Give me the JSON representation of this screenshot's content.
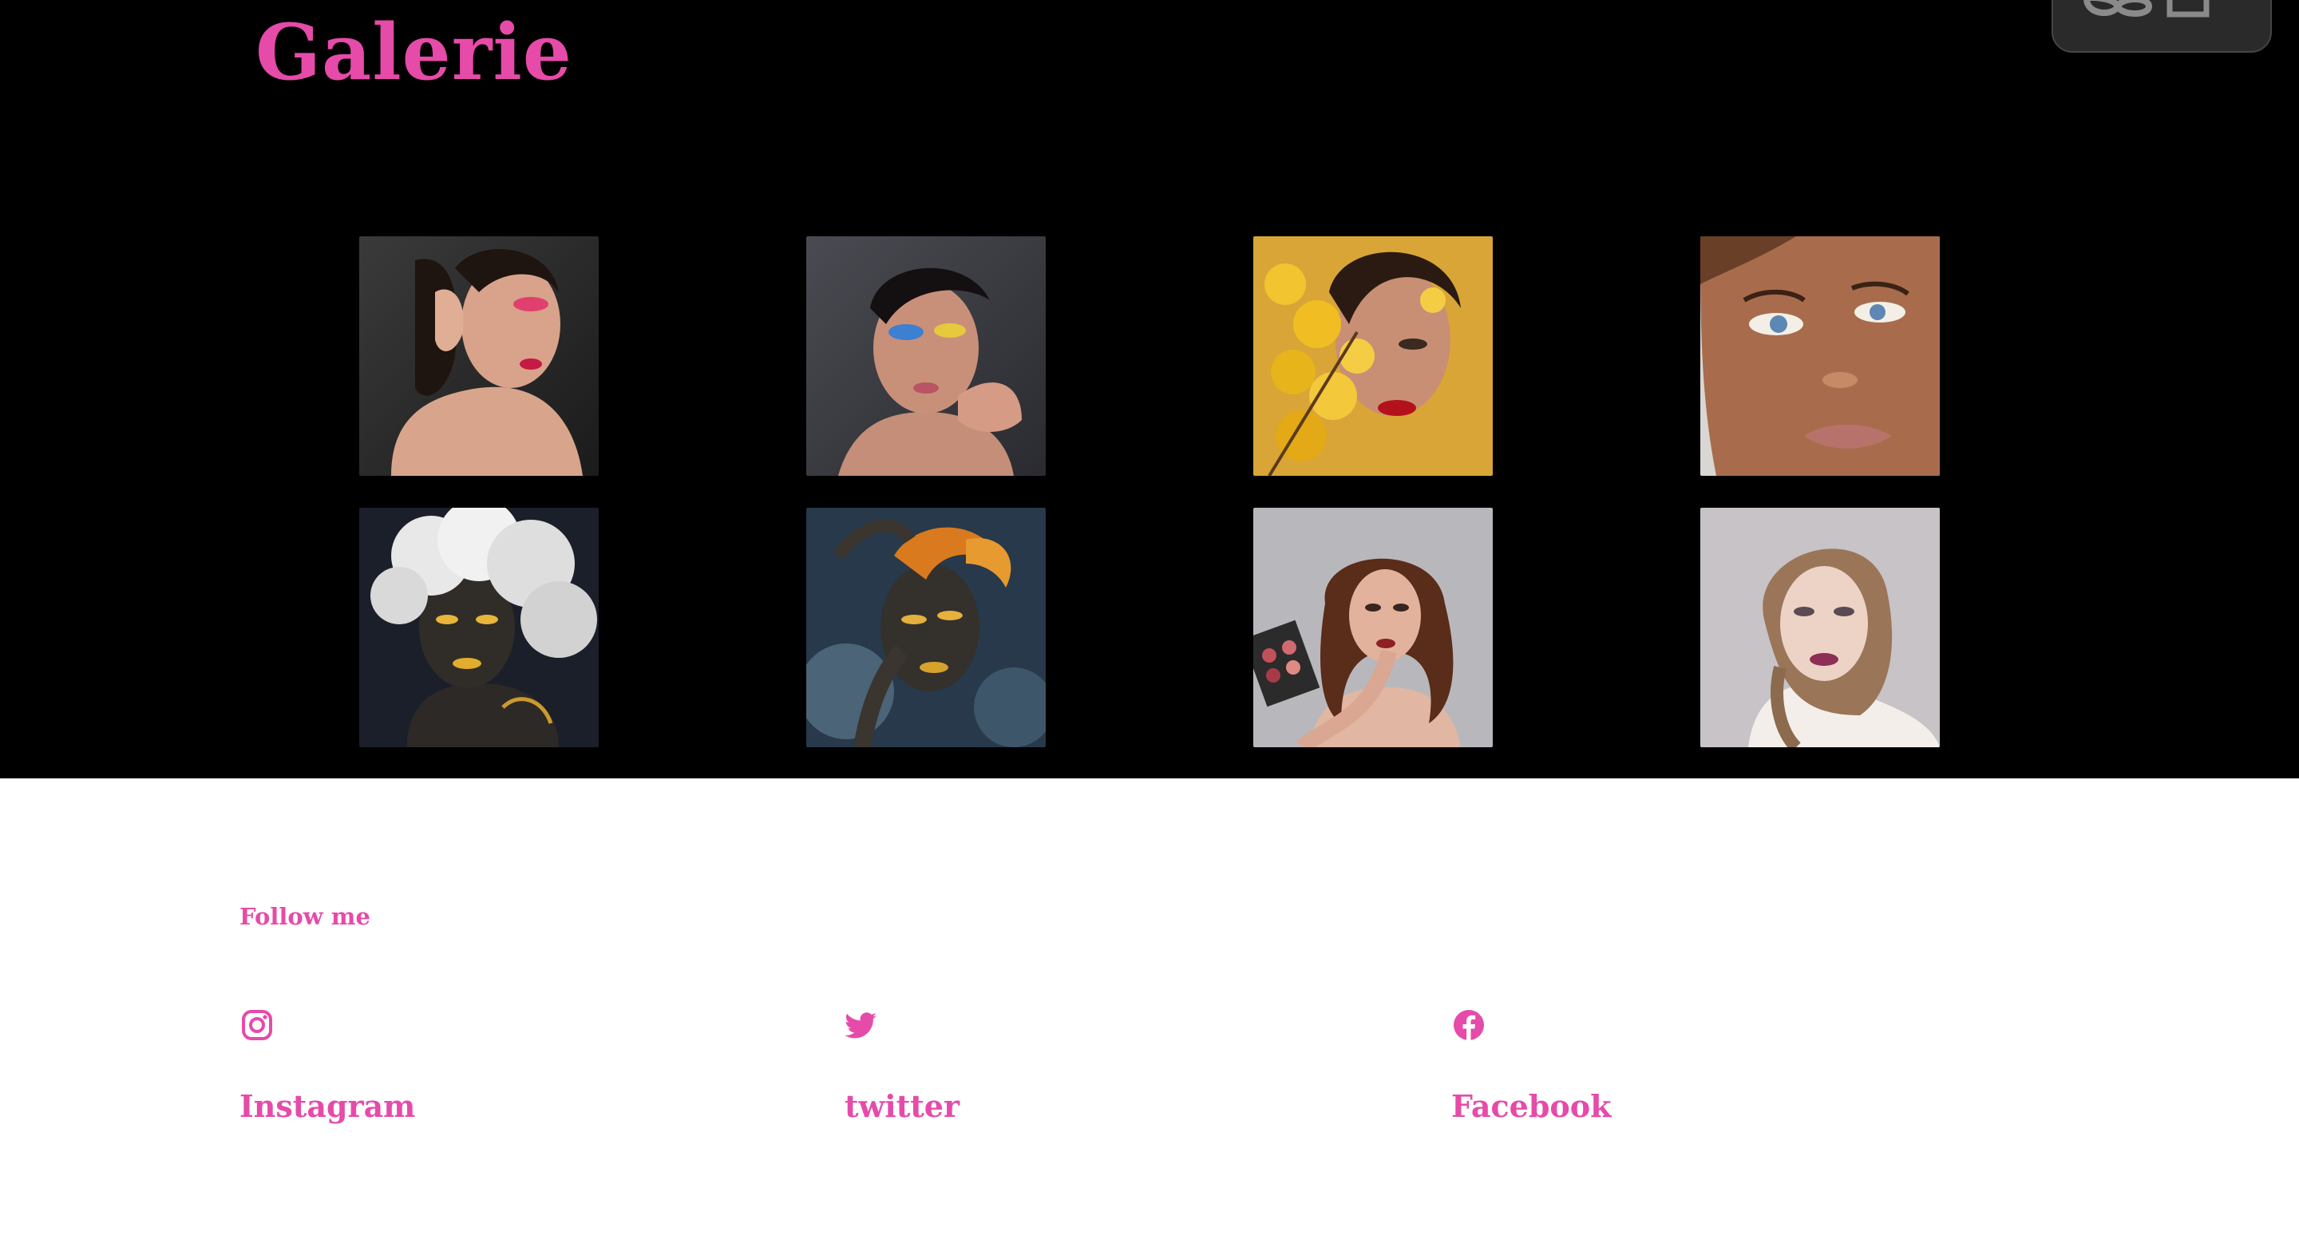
{
  "page": {
    "title": "Galerie"
  },
  "colors": {
    "accent": "#e64ba9",
    "hero_background": "#000000",
    "footer_background": "#ffffff"
  },
  "gallery": {
    "images": [
      {
        "name": "portrait-pink-eyeshadow"
      },
      {
        "name": "portrait-blue-yellow-eyeshadow"
      },
      {
        "name": "portrait-yellow-flowers"
      },
      {
        "name": "portrait-bronze-glow"
      },
      {
        "name": "portrait-gold-smoke"
      },
      {
        "name": "portrait-gold-orange-hair"
      },
      {
        "name": "portrait-makeup-artist"
      },
      {
        "name": "portrait-natural-mauve-lips"
      }
    ]
  },
  "footer": {
    "follow_heading": "Follow me",
    "social": [
      {
        "label": "Instagram",
        "icon": "instagram-icon"
      },
      {
        "label": "twitter",
        "icon": "twitter-icon"
      },
      {
        "label": "Facebook",
        "icon": "facebook-icon"
      }
    ]
  },
  "widget": {
    "icons": [
      "infinity-icon",
      "window-icon"
    ]
  }
}
